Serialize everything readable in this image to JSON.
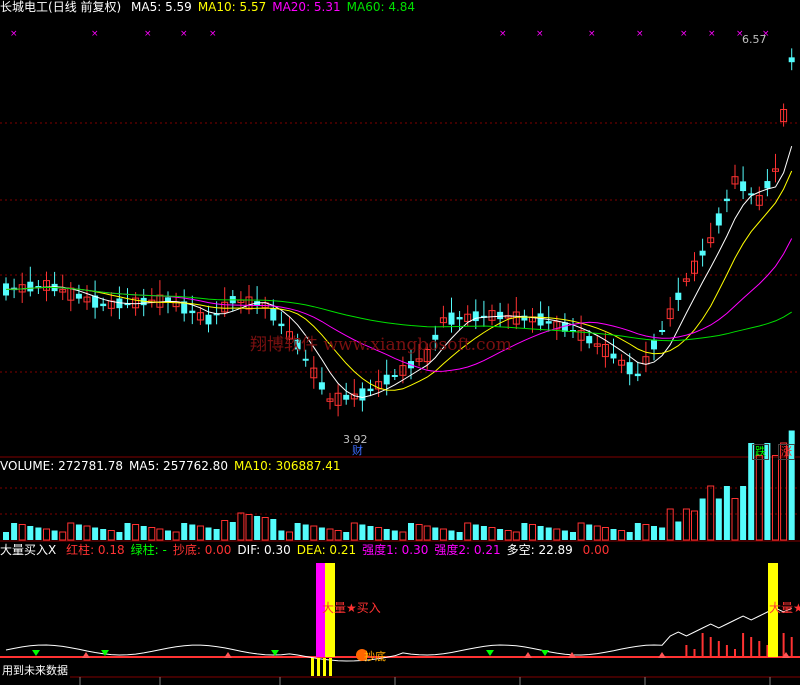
{
  "price_panel": {
    "stock_name": "长城电工",
    "period_label": "(日线 前复权)",
    "ma": [
      {
        "label": "MA5:",
        "value": "5.59",
        "color": "#ffffff"
      },
      {
        "label": "MA10:",
        "value": "5.57",
        "color": "#ffff00"
      },
      {
        "label": "MA20:",
        "value": "5.31",
        "color": "#ff00ff"
      },
      {
        "label": "MA60:",
        "value": "4.84",
        "color": "#00e000"
      }
    ],
    "high_label": "6.57",
    "low_label": "3.92",
    "finance_marker": "财",
    "watermark": "翔博软件 www.xiangbosoft.com",
    "btn_fall": "跌",
    "btn_rise": "涨"
  },
  "volume_panel": {
    "items": [
      {
        "label": "VOLUME:",
        "value": "272781.78",
        "color": "#ffffff"
      },
      {
        "label": "MA5:",
        "value": "257762.80",
        "color": "#ffffff"
      },
      {
        "label": "MA10:",
        "value": "306887.41",
        "color": "#ffff00"
      }
    ]
  },
  "indicator_panel": {
    "name": "大量买入X",
    "items": [
      {
        "label": "红柱:",
        "value": "0.18",
        "color": "#ff3333"
      },
      {
        "label": "绿柱:",
        "value": "-",
        "color": "#00ff00"
      },
      {
        "label": "抄底:",
        "value": "0.00",
        "color": "#ff3333"
      },
      {
        "label": "DIF:",
        "value": "0.30",
        "color": "#ffffff"
      },
      {
        "label": "DEA:",
        "value": "0.21",
        "color": "#ffff00"
      },
      {
        "label": "强度1:",
        "value": "0.30",
        "color": "#ff00ff"
      },
      {
        "label": "强度2:",
        "value": "0.21",
        "color": "#ff00ff"
      },
      {
        "label": "多空:",
        "value": "22.89",
        "color": "#ffffff"
      },
      {
        "label": "",
        "value": "0.00",
        "color": "#ff3333"
      }
    ],
    "signal_buy_label": "大量★买入",
    "signal_bottom_label": "抄底",
    "footer_note": "用到未来数据"
  },
  "colors": {
    "up": "#ff3232",
    "down": "#54fcfc",
    "grid": "#800000",
    "ma5": "#ffffff",
    "ma10": "#ffff00",
    "ma20": "#ff00ff",
    "ma60": "#00e000",
    "magenta": "#ff00ff",
    "yellow": "#ffff00"
  }
}
